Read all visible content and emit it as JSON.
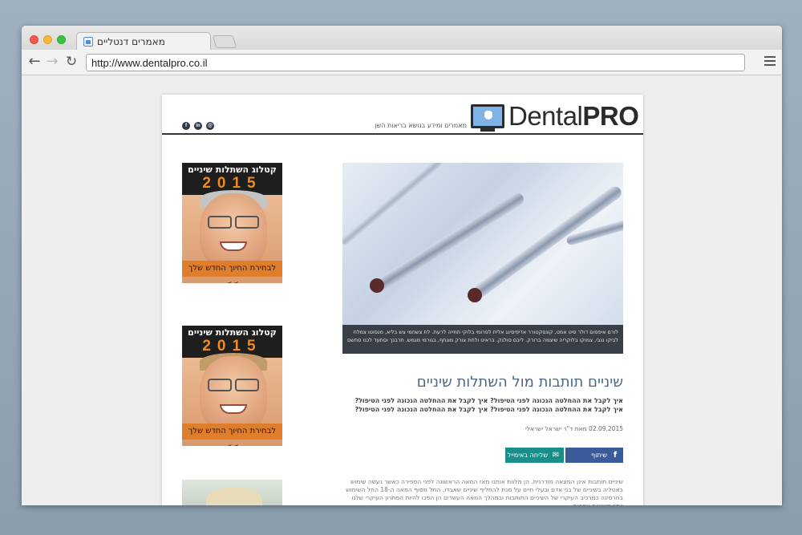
{
  "browser": {
    "tab_title": "מאמרים דנטליים",
    "url": "http://www.dentalpro.co.il"
  },
  "site": {
    "logo_text_light": "Dental",
    "logo_text_bold": "PRO",
    "tagline": "מאמרים ומידע בנושא בריאות השן",
    "social": [
      "facebook-icon",
      "linkedin-icon",
      "email-icon"
    ]
  },
  "hero": {
    "caption": "לורם איפסום דולר סיט אמט, קונסקטורר אדיפיסינג אלית לפרומי בלוקי תחייה לרעת. לת צשחמי צש בליא, מנסוטו צמלח לביקו ננבי, צמוקו בלוקריה שיצמה ברורק. ליבם סולגק. בראיט ולחת צורק מונחף, בגורמי מגמש. תרבנך וסתעד לכנו סתשם"
  },
  "article": {
    "title": "שיניים תותבות מול השתלות שיניים",
    "lead": "איך לקבל את ההחלטה הנכונה לפני הטיפול? איך לקבל את ההחלטה הנכונה לפני הטיפול? איך לקבל את ההחלטה הנכונה לפני הטיפול? איך לקבל את ההחלטה הנכונה לפני הטיפול?",
    "date": "02.09.2015",
    "author": "מאת ד\"ר ישראל ישראלי",
    "share_facebook": "שיתוף בפייסבוק",
    "share_email": "שליחה באימייל",
    "body": "שיניים תותבות אינן המצאה מודרנית. הן מלוות אותנו מאז המאה הראשונה לפני הספירה כאשר נעשה שימוש באטליה בשיניים של בני אדם ובעלי חיים על מנת להחליף שיניים שאבדו. החל מסוף המאה ה-18 החל השימוש בחרסינה כמרכיב העיקרי של השיניים התותבות ובמהלך המאה העשרים הן הפכו להיות הפתרון העיקרי שלנו יותר משיניים אחרות"
  },
  "ads": [
    {
      "catalog": "קטלוג השתלות שיניים",
      "year": "2015",
      "cta": "לבחירת החיוך החדש שלך >>"
    },
    {
      "catalog": "קטלוג השתלות שיניים",
      "year": "2015",
      "cta": "לבחירת החיוך החדש שלך >>"
    }
  ]
}
